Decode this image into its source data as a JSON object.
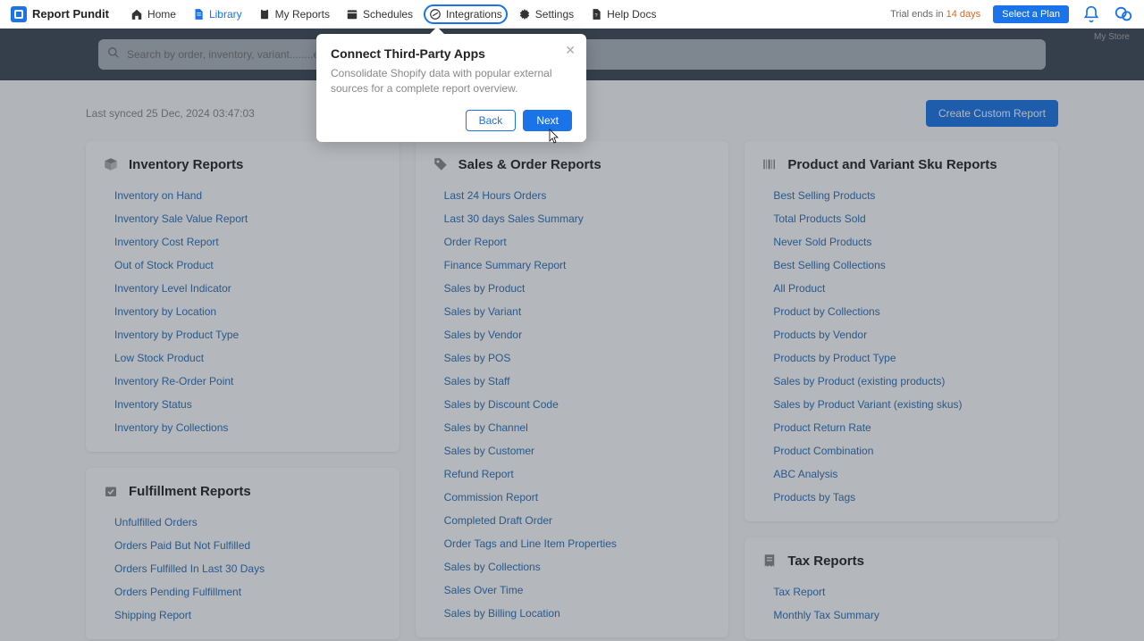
{
  "brand": "Report Pundit",
  "nav": [
    {
      "label": "Home"
    },
    {
      "label": "Library"
    },
    {
      "label": "My Reports"
    },
    {
      "label": "Schedules"
    },
    {
      "label": "Integrations"
    },
    {
      "label": "Settings"
    },
    {
      "label": "Help Docs"
    }
  ],
  "trial": {
    "prefix": "Trial ends in ",
    "days": "14 days"
  },
  "select_plan": "Select a Plan",
  "store_label": "My Store",
  "search_placeholder": "Search by order, inventory, variant........etc",
  "last_synced": "Last synced 25 Dec, 2024 03:47:03",
  "create_report": "Create Custom Report",
  "popover": {
    "title": "Connect Third-Party Apps",
    "body": "Consolidate Shopify data with popular external sources for a complete report overview.",
    "back": "Back",
    "next": "Next"
  },
  "sections": {
    "inventory": {
      "title": "Inventory Reports",
      "items": [
        "Inventory on Hand",
        "Inventory Sale Value Report",
        "Inventory Cost Report",
        "Out of Stock Product",
        "Inventory Level Indicator",
        "Inventory by Location",
        "Inventory by Product Type",
        "Low Stock Product",
        "Inventory Re-Order Point",
        "Inventory Status",
        "Inventory by Collections"
      ]
    },
    "fulfillment": {
      "title": "Fulfillment Reports",
      "items": [
        "Unfulfilled Orders",
        "Orders Paid But Not Fulfilled",
        "Orders Fulfilled In Last 30 Days",
        "Orders Pending Fulfillment",
        "Shipping Report"
      ]
    },
    "sales": {
      "title": "Sales & Order Reports",
      "items": [
        "Last 24 Hours Orders",
        "Last 30 days Sales Summary",
        "Order Report",
        "Finance Summary Report",
        "Sales by Product",
        "Sales by Variant",
        "Sales by Vendor",
        "Sales by POS",
        "Sales by Staff",
        "Sales by Discount Code",
        "Sales by Channel",
        "Sales by Customer",
        "Refund Report",
        "Commission Report",
        "Completed Draft Order",
        "Order Tags and Line Item Properties",
        "Sales by Collections",
        "Sales Over Time",
        "Sales by Billing Location"
      ]
    },
    "product": {
      "title": "Product and Variant Sku Reports",
      "items": [
        "Best Selling Products",
        "Total Products Sold",
        "Never Sold Products",
        "Best Selling Collections",
        "All Product",
        "Product by Collections",
        "Products by Vendor",
        "Products by Product Type",
        "Sales by Product (existing products)",
        "Sales by Product Variant (existing skus)",
        "Product Return Rate",
        "Product Combination",
        "ABC Analysis",
        "Products by Tags"
      ]
    },
    "tax": {
      "title": "Tax Reports",
      "items": [
        "Tax Report",
        "Monthly Tax Summary"
      ]
    }
  }
}
